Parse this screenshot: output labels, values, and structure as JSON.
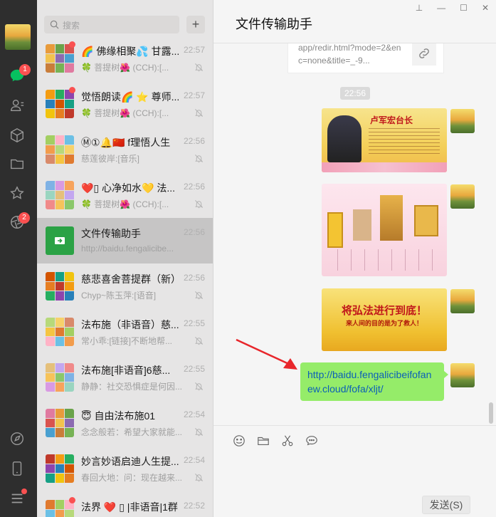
{
  "search": {
    "placeholder": "搜索"
  },
  "nav": {
    "chat_badge": "1",
    "moments_badge": "2"
  },
  "chats": [
    {
      "name": "🌈 佛缘相聚💦 甘露...",
      "preview": "🍀 菩提树🌺 (CCH):[...",
      "time": "22:57",
      "muted": true,
      "dot": true
    },
    {
      "name": "觉悟朗读🌈 ⭐ 尊师...",
      "preview": "🍀 菩提树🌺 (CCH):[...",
      "time": "22:57",
      "muted": true,
      "dot": true
    },
    {
      "name": "Ⓜ①🔔🇨🇳 f理悟人生",
      "preview": "慈莲彼岸:[音乐]",
      "time": "22:56",
      "muted": true,
      "dot": false
    },
    {
      "name": "❤️▯ 心净如水💛 法...",
      "preview": "🍀 菩提树🌺 (CCH):[...",
      "time": "22:56",
      "muted": true,
      "dot": false
    },
    {
      "name": "文件传输助手",
      "preview": "http://baidu.fengalicibe...",
      "time": "22:56",
      "muted": false,
      "dot": false,
      "active": true
    },
    {
      "name": "慈悲喜舍菩提群（新）",
      "preview": "Chyp~陈玉萍:[语音]",
      "time": "22:56",
      "muted": true,
      "dot": false
    },
    {
      "name": "法布施（非语音）慈...",
      "preview": "常小乖:[链接]不断地帮...",
      "time": "22:55",
      "muted": true,
      "dot": false
    },
    {
      "name": "法布施[非语音]6慈...",
      "preview": "静静：社交恐惧症是何因...",
      "time": "22:55",
      "muted": true,
      "dot": false
    },
    {
      "name": "😇 自由法布施01",
      "preview": "念念般若：希望大家就能...",
      "time": "22:54",
      "muted": true,
      "dot": false
    },
    {
      "name": "妙言妙语启迪人生提...",
      "preview": "春回大地：问：现在越来...",
      "time": "22:54",
      "muted": true,
      "dot": false
    },
    {
      "name": "法界 ❤️ ▯ |非语音|1群",
      "preview": "",
      "time": "22:52",
      "muted": true,
      "dot": true
    }
  ],
  "main": {
    "title": "文件传输助手",
    "link_card_text": "app/redir.html?mode=2&enc=none&title=_-9...",
    "time_pill": "22:56",
    "img1_title": "卢军宏台长",
    "img3_title": "将弘法进行到底！",
    "img3_sub": "来人间的目的是为了救人！",
    "link_bubble": "http://baidu.fengalicibeifofanew.cloud/fofa/xljt/",
    "send_label": "发送(S)"
  },
  "colors": {
    "accent": "#95ec69",
    "badge": "#fa5151",
    "nav_bg": "#2e2e2e",
    "file_helper": "#2ba245"
  }
}
